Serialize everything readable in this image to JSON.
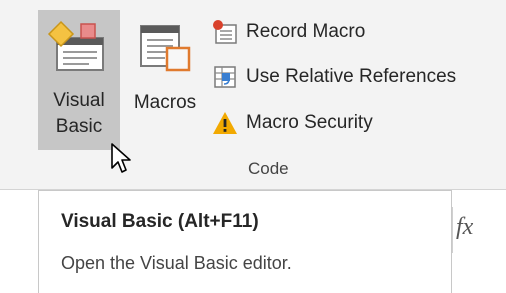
{
  "code_group": {
    "visual_basic": {
      "line1": "Visual",
      "line2": "Basic"
    },
    "macros": {
      "label": "Macros"
    },
    "record_macro": "Record Macro",
    "use_relative_references": "Use Relative References",
    "macro_security": "Macro Security",
    "group_label": "Code"
  },
  "tooltip": {
    "title": "Visual Basic (Alt+F11)",
    "description": "Open the Visual Basic editor."
  },
  "formula_bar": {
    "fx_label": "fx"
  },
  "colors": {
    "active_button": "#c6c6c6",
    "ribbon_bg": "#f3f3f3",
    "warning": "#f2a900"
  }
}
